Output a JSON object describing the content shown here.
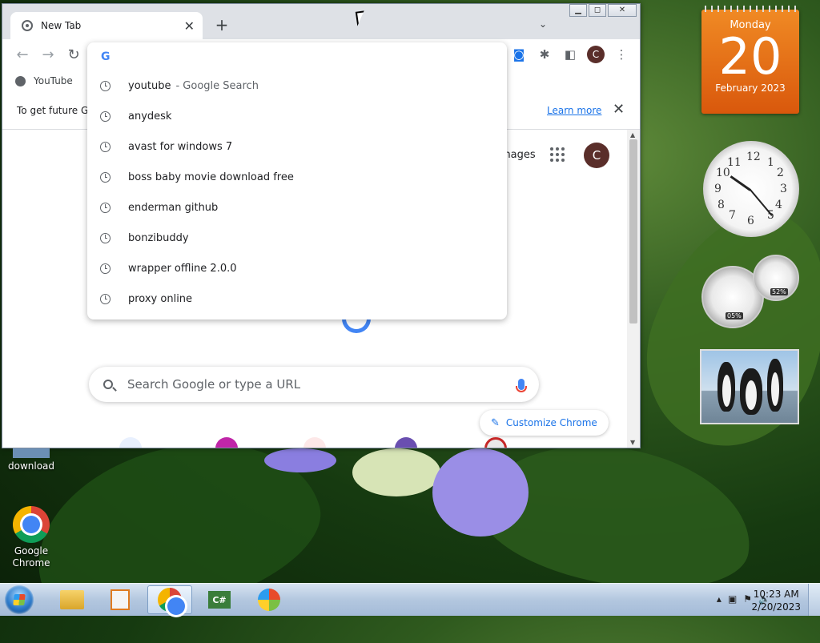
{
  "browser": {
    "tab_title": "New Tab",
    "new_tab_symbol": "+",
    "tab_close_symbol": "✕",
    "bookmark": "YouTube",
    "omnibox": {
      "value": "",
      "suggestions": [
        {
          "text": "youtube",
          "sub": "- Google Search"
        },
        {
          "text": "anydesk",
          "sub": ""
        },
        {
          "text": "avast for windows 7",
          "sub": ""
        },
        {
          "text": "boss baby movie download free",
          "sub": ""
        },
        {
          "text": "enderman github",
          "sub": ""
        },
        {
          "text": "bonzibuddy",
          "sub": ""
        },
        {
          "text": "wrapper offline 2.0.0",
          "sub": ""
        },
        {
          "text": "proxy online",
          "sub": ""
        }
      ]
    },
    "infobar": {
      "text": "To get future G",
      "learn_more": "Learn more",
      "close": "✕"
    },
    "profile_initial": "C",
    "ntp": {
      "images_link": "mages",
      "search_placeholder": "Search Google or type a URL",
      "customize_label": "Customize Chrome",
      "profile_initial": "C"
    }
  },
  "desktop": {
    "icons": [
      {
        "label": "download"
      },
      {
        "label": "Google Chrome"
      }
    ]
  },
  "gadgets": {
    "calendar": {
      "weekday": "Monday",
      "day": "20",
      "month_year": "February 2023"
    },
    "clock_numbers": [
      "12",
      "1",
      "2",
      "3",
      "4",
      "5",
      "6",
      "7",
      "8",
      "9",
      "10",
      "11"
    ],
    "cpu_meter": {
      "cpu": "05%",
      "memory": "52%"
    }
  },
  "taskbar": {
    "time": "10:23 AM",
    "date": "2/20/2023",
    "pinned": [
      "explorer",
      "media-player",
      "chrome",
      "csharp-app",
      "windows-update"
    ]
  },
  "colors": {
    "accent_blue": "#1a73e8",
    "profile_brown": "#5a2e2a",
    "calendar_orange": "#e66a17"
  }
}
